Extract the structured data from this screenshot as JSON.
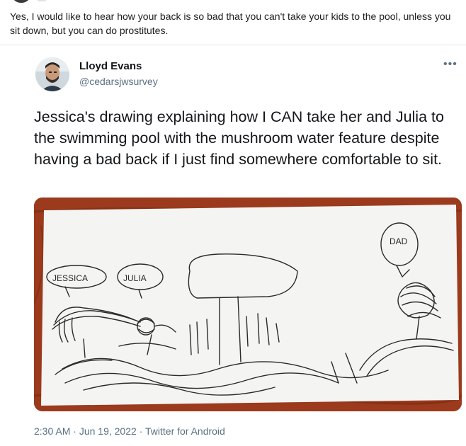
{
  "comment": {
    "text": "Yes, I would like to hear how your back is so bad that you can't take your kids to the pool, unless you sit down, but you can do prostitutes."
  },
  "tweet": {
    "author_name": "Lloyd Evans",
    "author_handle": "@cedarsjwsurvey",
    "more_icon": "more-dots-icon",
    "text": "Jessica's drawing explaining how I CAN take her and Julia to the swimming pool with the mushroom water feature despite having a bad back if I just find somewhere comfortable to sit.",
    "time": "2:30 AM",
    "separator": "·",
    "date": "Jun 19, 2022",
    "source": "Twitter for Android"
  },
  "drawing": {
    "label_jessica": "JESSICA",
    "label_julia": "JULIA",
    "label_dad": "DAD"
  },
  "colors": {
    "handle_gray": "#5b7083",
    "wood_background": "#9b3a1c",
    "paper": "#f4f4f2",
    "pencil": "#2a2a2a"
  }
}
